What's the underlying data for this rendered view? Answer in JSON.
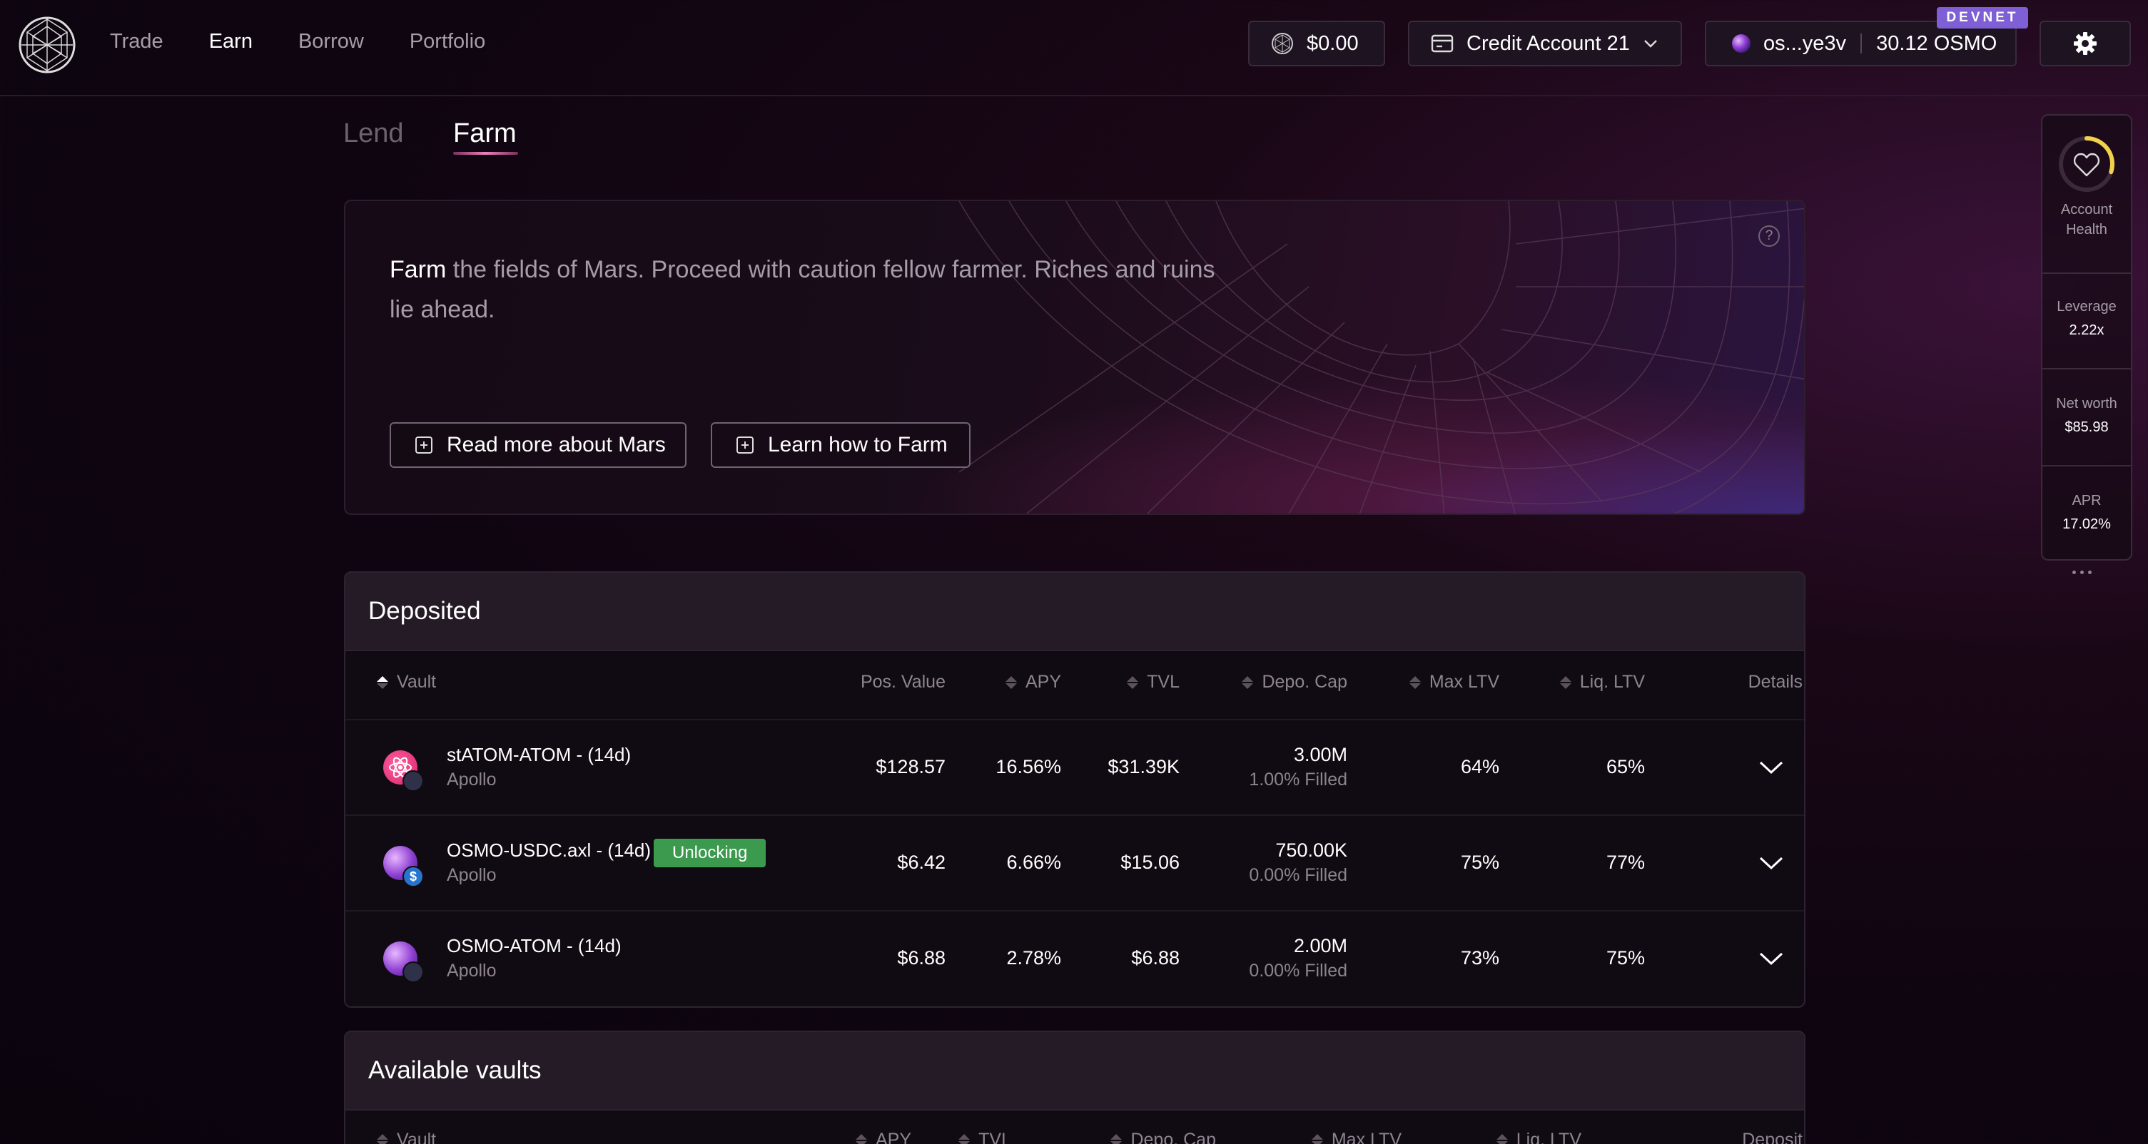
{
  "header": {
    "nav": [
      "Trade",
      "Earn",
      "Borrow",
      "Portfolio"
    ],
    "active_nav": "Earn",
    "balance": "$0.00",
    "account": "Credit Account 21",
    "wallet_address": "os...ye3v",
    "wallet_balance": "30.12 OSMO",
    "network_badge": "DEVNET"
  },
  "tabs": {
    "lend": "Lend",
    "farm": "Farm"
  },
  "intro": {
    "highlight": "Farm",
    "text": " the fields of Mars. Proceed with caution fellow farmer. Riches and ruins lie ahead.",
    "help": "?",
    "button_read_more": "Read more about Mars",
    "button_learn": "Learn how to Farm"
  },
  "deposited": {
    "title": "Deposited",
    "columns": [
      "Vault",
      "Pos. Value",
      "APY",
      "TVL",
      "Depo. Cap",
      "Max LTV",
      "Liq. LTV",
      "Details"
    ],
    "rows": [
      {
        "name": "stATOM-ATOM - (14d)",
        "provider": "Apollo",
        "badge": "",
        "pos_value": "$128.57",
        "apy": "16.56%",
        "tvl": "$31.39K",
        "cap": "3.00M",
        "cap_filled": "1.00% Filled",
        "max_ltv": "64%",
        "liq_ltv": "65%",
        "icon": "statom-atom-icon"
      },
      {
        "name": "OSMO-USDC.axl - (14d)",
        "provider": "Apollo",
        "badge": "Unlocking",
        "pos_value": "$6.42",
        "apy": "6.66%",
        "tvl": "$15.06",
        "cap": "750.00K",
        "cap_filled": "0.00% Filled",
        "max_ltv": "75%",
        "liq_ltv": "77%",
        "icon": "osmo-usdc-icon"
      },
      {
        "name": "OSMO-ATOM - (14d)",
        "provider": "Apollo",
        "badge": "",
        "pos_value": "$6.88",
        "apy": "2.78%",
        "tvl": "$6.88",
        "cap": "2.00M",
        "cap_filled": "0.00% Filled",
        "max_ltv": "73%",
        "liq_ltv": "75%",
        "icon": "osmo-atom-icon"
      }
    ]
  },
  "available": {
    "title": "Available vaults",
    "columns": [
      "Vault",
      "APY",
      "TVL",
      "Depo. Cap",
      "Max LTV",
      "Liq. LTV",
      "Deposit"
    ]
  },
  "sidebar": {
    "health_label": "Account Health",
    "health_level": 0.3,
    "leverage_label": "Leverage",
    "leverage": "2.22x",
    "networth_label": "Net worth",
    "networth": "$85.98",
    "apr_label": "APR",
    "apr": "17.02%"
  },
  "colors": {
    "accent_pink": "#f07fbf",
    "badge_green": "#3c9a4f",
    "devnet_purple": "#7e5fd6",
    "health_yellow": "#f2d24b"
  }
}
